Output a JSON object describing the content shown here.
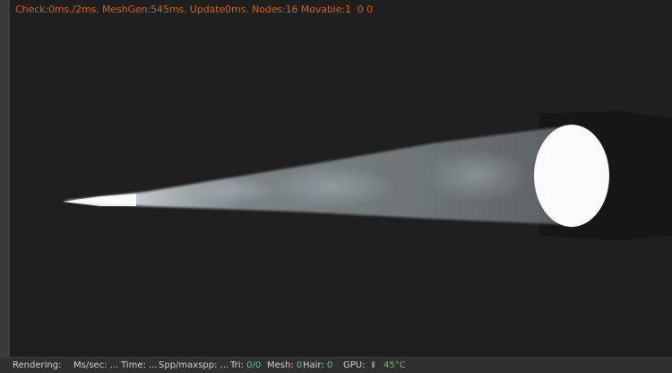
{
  "viewport": {
    "stats_text": "Check:0ms./2ms. MeshGen:545ms. Update0ms. Nodes:16 Movable:1  0 0"
  },
  "status_bar": {
    "rendering_label": "Rendering:",
    "ms_sec_label": "Ms/sec: ...",
    "time_label": "Time: ...",
    "spp_label": "Spp/maxspp: ...",
    "tri_label": "Tri:",
    "tri_value": "0/0",
    "mesh_label": "Mesh:",
    "mesh_value": "0",
    "hair_label": "Hair:",
    "hair_value": "0",
    "gpu_label": "GPU:",
    "gpu_temp": "45°C"
  },
  "colors": {
    "stats_text": "#c8651a",
    "status_value": "#55c4a8",
    "gpu_indicator": "#3fae4a"
  }
}
